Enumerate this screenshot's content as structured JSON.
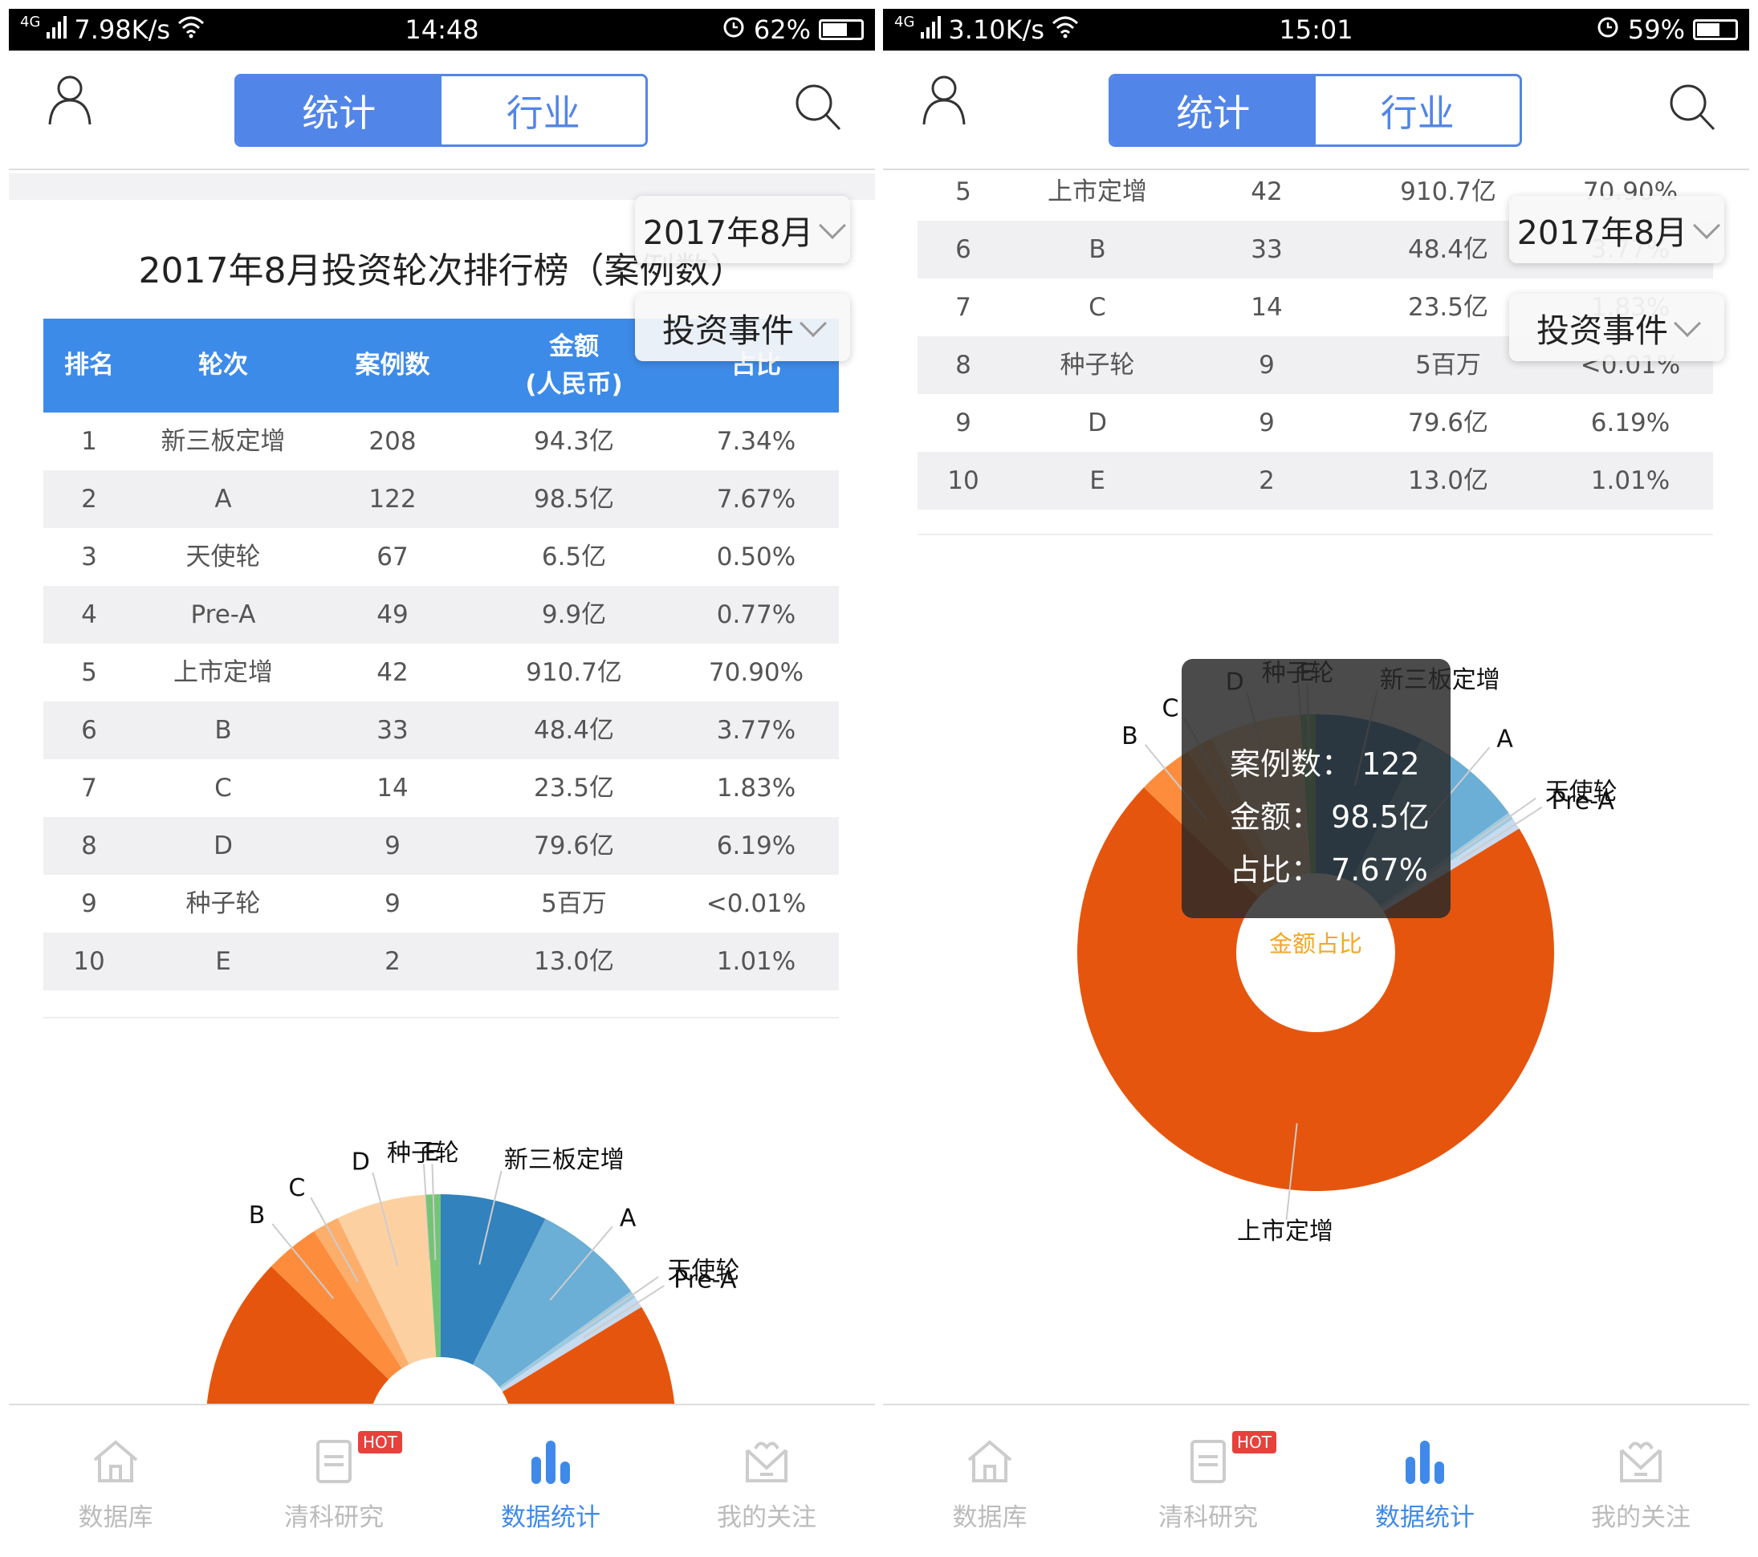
{
  "panels": [
    {
      "status": {
        "network": "4G",
        "speed": "7.98K/s",
        "time": "14:48",
        "battery": "62%",
        "battery_level": 0.62
      },
      "tabs": [
        "统计",
        "行业"
      ],
      "filters": {
        "month": "2017年8月",
        "type": "投资事件"
      },
      "title": "2017年8月投资轮次排行榜（案例数）",
      "table": {
        "headers": [
          "排名",
          "轮次",
          "案例数",
          "金额",
          "(人民币)",
          "占比"
        ],
        "rows": [
          [
            "1",
            "新三板定增",
            "208",
            "94.3亿",
            "7.34%"
          ],
          [
            "2",
            "A",
            "122",
            "98.5亿",
            "7.67%"
          ],
          [
            "3",
            "天使轮",
            "67",
            "6.5亿",
            "0.50%"
          ],
          [
            "4",
            "Pre-A",
            "49",
            "9.9亿",
            "0.77%"
          ],
          [
            "5",
            "上市定增",
            "42",
            "910.7亿",
            "70.90%"
          ],
          [
            "6",
            "B",
            "33",
            "48.4亿",
            "3.77%"
          ],
          [
            "7",
            "C",
            "14",
            "23.5亿",
            "1.83%"
          ],
          [
            "8",
            "D",
            "9",
            "79.6亿",
            "6.19%"
          ],
          [
            "9",
            "种子轮",
            "9",
            "5百万",
            "<0.01%"
          ],
          [
            "10",
            "E",
            "2",
            "13.0亿",
            "1.01%"
          ]
        ]
      }
    },
    {
      "status": {
        "network": "4G",
        "speed": "3.10K/s",
        "time": "15:01",
        "battery": "59%",
        "battery_level": 0.59
      },
      "tabs": [
        "统计",
        "行业"
      ],
      "filters": {
        "month": "2017年8月",
        "type": "投资事件"
      },
      "table": {
        "rows": [
          [
            "5",
            "上市定增",
            "42",
            "910.7亿",
            "70.90%"
          ],
          [
            "6",
            "B",
            "33",
            "48.4亿",
            "3.77%"
          ],
          [
            "7",
            "C",
            "14",
            "23.5亿",
            "1.83%"
          ],
          [
            "8",
            "种子轮",
            "9",
            "5百万",
            "<0.01%"
          ],
          [
            "9",
            "D",
            "9",
            "79.6亿",
            "6.19%"
          ],
          [
            "10",
            "E",
            "2",
            "13.0亿",
            "1.01%"
          ]
        ]
      },
      "tooltip": {
        "cases": "案例数：  122",
        "amount": "金额：  98.5亿",
        "share": "占比：  7.67%"
      },
      "center_label": "金额占比"
    }
  ],
  "chart_data": {
    "type": "pie",
    "donut": true,
    "title": "金额占比",
    "unit": "亿",
    "categories": [
      "新三板定增",
      "A",
      "天使轮",
      "Pre-A",
      "上市定增",
      "B",
      "C",
      "D",
      "种子轮",
      "E"
    ],
    "values": [
      94.3,
      98.5,
      6.5,
      9.9,
      910.7,
      48.4,
      23.5,
      79.6,
      0.05,
      13.0
    ],
    "colors": [
      "#3182bd",
      "#6baed6",
      "#9ecae1",
      "#c6dbef",
      "#e6550d",
      "#fd8d3c",
      "#fdae6b",
      "#fdd0a2",
      "#fdd0a2",
      "#74c476"
    ]
  },
  "nav": {
    "items": [
      {
        "label": "数据库",
        "icon": "home-icon"
      },
      {
        "label": "清科研究",
        "icon": "document-icon",
        "badge": "HOT"
      },
      {
        "label": "数据统计",
        "icon": "bar-chart-icon",
        "active": true
      },
      {
        "label": "我的关注",
        "icon": "heart-mail-icon"
      }
    ]
  },
  "colors": {
    "accent": "#5285e8",
    "table_header": "#3d8be8",
    "active_nav": "#3f8ae8",
    "hot_badge": "#e8403b",
    "center_label": "#f5a623"
  }
}
